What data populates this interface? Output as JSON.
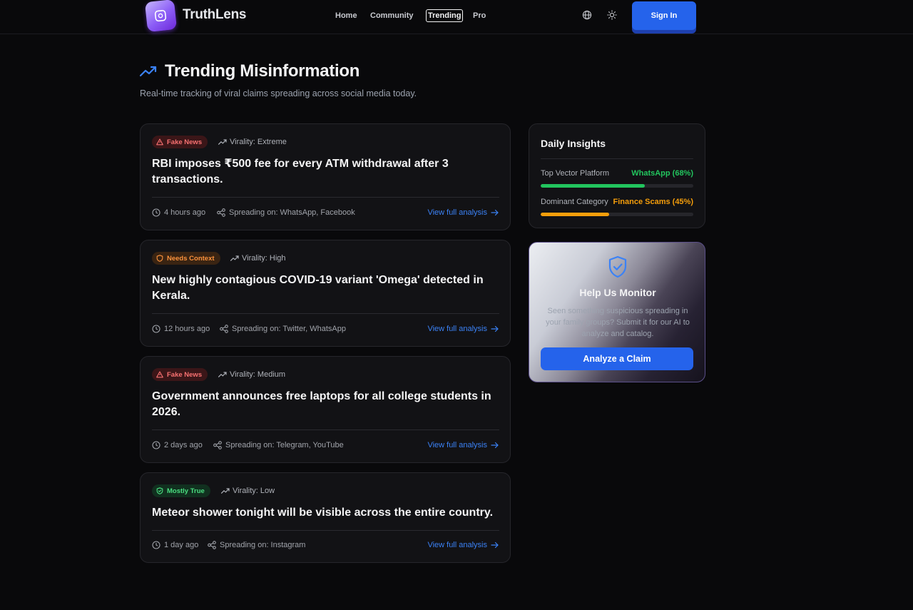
{
  "header": {
    "brand": "TruthLens",
    "nav": [
      {
        "label": "Home",
        "active": false
      },
      {
        "label": "Community",
        "active": false
      },
      {
        "label": "Trending",
        "active": true
      },
      {
        "label": "Pro",
        "active": false
      }
    ],
    "sign_in_label": "Sign In",
    "icons": [
      "globe-icon",
      "sun-icon"
    ]
  },
  "page": {
    "title": "Trending Misinformation",
    "subtitle": "Real-time tracking of viral claims spreading across social media today."
  },
  "claims": [
    {
      "badge": "Fake News",
      "badge_type": "fake",
      "virality": "Virality: Extreme",
      "title": "RBI imposes ₹500 fee for every ATM withdrawal after 3 transactions.",
      "time": "4 hours ago",
      "spreading": "Spreading on: WhatsApp, Facebook",
      "link": "View full analysis"
    },
    {
      "badge": "Needs Context",
      "badge_type": "context",
      "virality": "Virality: High",
      "title": "New highly contagious COVID-19 variant 'Omega' detected in Kerala.",
      "time": "12 hours ago",
      "spreading": "Spreading on: Twitter, WhatsApp",
      "link": "View full analysis"
    },
    {
      "badge": "Fake News",
      "badge_type": "fake",
      "virality": "Virality: Medium",
      "title": "Government announces free laptops for all college students in 2026.",
      "time": "2 days ago",
      "spreading": "Spreading on: Telegram, YouTube",
      "link": "View full analysis"
    },
    {
      "badge": "Mostly True",
      "badge_type": "true",
      "virality": "Virality: Low",
      "title": "Meteor shower tonight will be visible across the entire country.",
      "time": "1 day ago",
      "spreading": "Spreading on: Instagram",
      "link": "View full analysis"
    }
  ],
  "insights": {
    "title": "Daily Insights",
    "stats": [
      {
        "label": "Top Vector Platform",
        "value": "WhatsApp (68%)",
        "percent": 68,
        "color": "#22c55e"
      },
      {
        "label": "Dominant Category",
        "value": "Finance Scams (45%)",
        "percent": 45,
        "color": "#f59e0b"
      }
    ]
  },
  "help": {
    "title": "Help Us Monitor",
    "body": "Seen something suspicious spreading in your family groups? Submit it for our AI to analyze and catalog.",
    "button": "Analyze a Claim"
  },
  "colors": {
    "accent": "#2563eb",
    "fake": "#f87171",
    "context": "#fb923c",
    "true": "#4ade80"
  }
}
